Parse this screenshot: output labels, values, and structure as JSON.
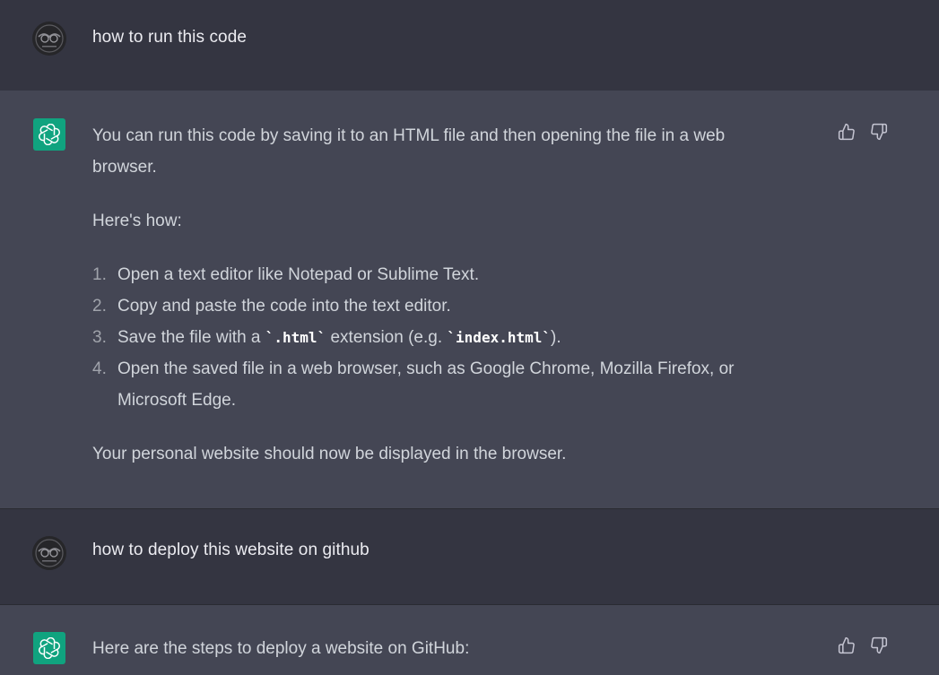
{
  "conversation": {
    "user_message_1": "how to run this code",
    "assistant_message_1": {
      "intro": "You can run this code by saving it to an HTML file and then opening the file in a web browser.",
      "heres_how": "Here's how:",
      "steps": [
        {
          "num": "1.",
          "text": "Open a text editor like Notepad or Sublime Text."
        },
        {
          "num": "2.",
          "text": "Copy and paste the code into the text editor."
        },
        {
          "num": "3.",
          "pre": "Save the file with a ",
          "code1": "`.html`",
          "mid": " extension (e.g. ",
          "code2": "`index.html`",
          "post": ")."
        },
        {
          "num": "4.",
          "text": "Open the saved file in a web browser, such as Google Chrome, Mozilla Firefox, or Microsoft Edge."
        }
      ],
      "closing": "Your personal website should now be displayed in the browser."
    },
    "user_message_2": "how to deploy this website on github",
    "assistant_message_2": {
      "intro": "Here are the steps to deploy a website on GitHub:"
    }
  },
  "icons": {
    "user_avatar": "user-avatar-icon",
    "assistant_avatar": "openai-logo-icon",
    "thumbs_up": "thumbs-up-icon",
    "thumbs_down": "thumbs-down-icon"
  },
  "colors": {
    "user_bg": "#343541",
    "assistant_bg": "#444654",
    "brand_green": "#10a37f",
    "text": "#d1d5db"
  }
}
